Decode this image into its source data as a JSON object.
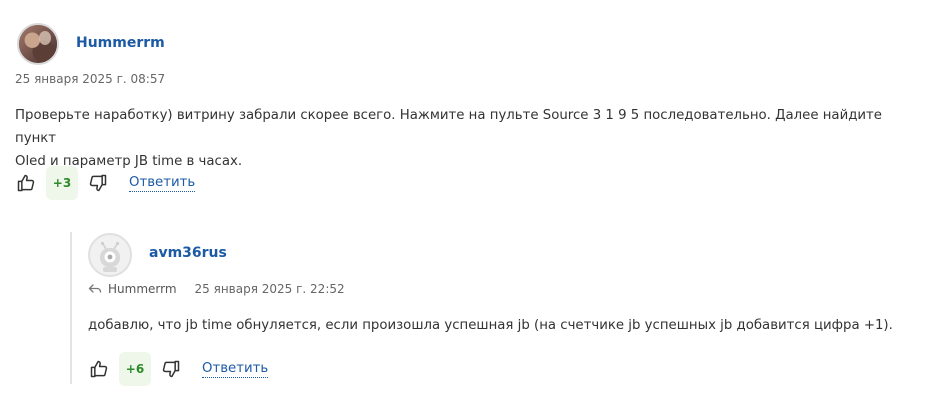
{
  "comments": [
    {
      "author": "Hummerrm",
      "timestamp": "25 января 2025 г. 08:57",
      "text_line1": "Проверьте наработку) витрину забрали скорее всего. Нажмите на пульте Source 3 1 9 5 последовательно. Далее найдите пункт",
      "text_line2": "Oled и параметр JB time в часах.",
      "score": "+3",
      "reply_label": "Ответить",
      "icons": [
        "thumbs-up-icon",
        "thumbs-down-icon"
      ]
    },
    {
      "author": "avm36rus",
      "reply_to": "Hummerrm",
      "timestamp": "25 января 2025 г. 22:52",
      "text": "добавлю, что jb time обнуляется, если произошла успешная jb (на счетчике jb успешных jb добавится цифра +1).",
      "score": "+6",
      "reply_label": "Ответить",
      "icons": [
        "reply-arrow-icon",
        "robot-avatar-icon",
        "thumbs-up-icon",
        "thumbs-down-icon"
      ]
    }
  ],
  "colors": {
    "accent": "#1c5aa6",
    "score_bg": "#eef7ea",
    "score_text": "#2f8a2b",
    "muted_text": "#666666",
    "thread_line": "#e3e3e3"
  }
}
